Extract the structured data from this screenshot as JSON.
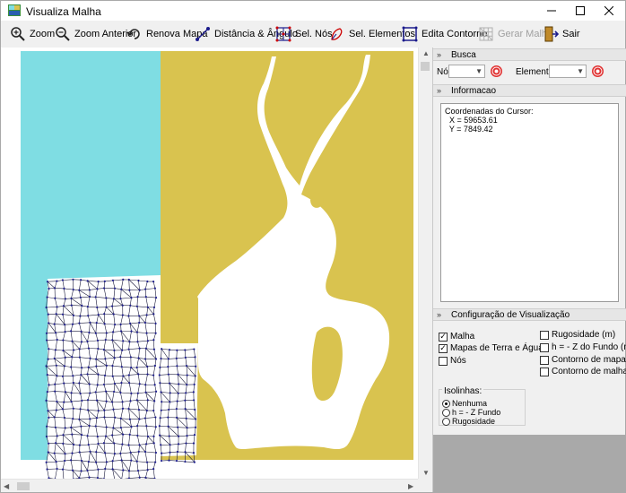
{
  "window": {
    "title": "Visualiza Malha",
    "controls": [
      "minimize",
      "maximize",
      "close"
    ]
  },
  "toolbar": {
    "zoom": "Zoom",
    "zoom_anterior": "Zoom Anterior",
    "renova_mapa": "Renova Mapa",
    "distancia_angulo": "Distância & Ângulo",
    "sel_nos": "Sel. Nós",
    "sel_elementos": "Sel. Elementos",
    "edita_contorno": "Edita  Contorno",
    "gerar_malha": "Gerar Malha",
    "sair": "Sair"
  },
  "map": {
    "colors": {
      "water_left": "#7fdde3",
      "land": "#d9c34f",
      "water": "#ffffff",
      "mesh_node": "#1c1c8c",
      "mesh_line": "#1a1a3a"
    }
  },
  "panel": {
    "busca": {
      "header": "Busca",
      "no_label": "Nó:",
      "no_value": "",
      "elemento_label": "Elemento:",
      "elemento_value": ""
    },
    "informacao": {
      "header": "Informacao",
      "lines": [
        "Coordenadas do Cursor:",
        "  X = 59653.61",
        "  Y = 7849.42"
      ]
    },
    "config": {
      "header": "Configuração de Visualização",
      "checks_left": [
        {
          "label": "Malha",
          "checked": true
        },
        {
          "label": "Mapas de Terra e Água",
          "checked": true
        },
        {
          "label": "Nós",
          "checked": false
        }
      ],
      "checks_right": [
        {
          "label": "Rugosidade (m)",
          "checked": false
        },
        {
          "label": "h = - Z do Fundo (m)",
          "checked": false
        },
        {
          "label": "Contorno de mapas",
          "checked": false
        },
        {
          "label": "Contorno de malha",
          "checked": false
        }
      ],
      "isolinhas_label": "Isolinhas:",
      "isolinhas": [
        {
          "label": "Nenhuma",
          "selected": true
        },
        {
          "label": "h = - Z Fundo",
          "selected": false
        },
        {
          "label": "Rugosidade",
          "selected": false
        }
      ]
    }
  }
}
